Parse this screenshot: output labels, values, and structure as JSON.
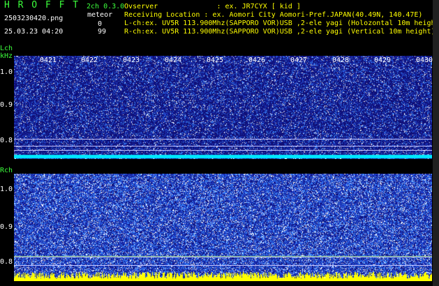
{
  "header": {
    "app_title": "H R O F F T",
    "channels": "2ch 0.3.0",
    "filename": "2503230420.png",
    "datetime": "25.03.23 04:20",
    "meteor_label": "meteor",
    "meteor_lch": "0",
    "meteor_rch": "99",
    "observer_line": "Ovserver              : ex. JR7CYX [ kid ]",
    "location_line": "Receiving Location : ex. Aomori City Aomori-Pref.JAPAN(40.49N, 140.47E)",
    "lch_line": "L-ch:ex. UV5R 113.900Mhz(SAPPORO VOR)USB ,2-ele yagi (Holozontal 10m height)",
    "rch_line": "R-ch:ex. UV5R 113.900Mhz(SAPPORO VOR)USB ,2-ele yagi (Vertical 10m height)"
  },
  "lch": {
    "label": "Lch",
    "unit": "kHz",
    "y_ticks": [
      "1.0",
      "0.9",
      "0.8"
    ],
    "time_ticks": [
      "0421",
      "0422",
      "0423",
      "0424",
      "0425",
      "0426",
      "0427",
      "0428",
      "0429",
      "0430"
    ]
  },
  "rch": {
    "label": "Rch",
    "y_ticks": [
      "1.0",
      "0.9",
      "0.8"
    ]
  },
  "colors": {
    "background": "#000000",
    "title_green": "#3cff3c",
    "noise_dark": "#101080",
    "noise_mid": "#3a7cff",
    "noise_bright": "#ffffff",
    "carrier_cyan": "#00ffff",
    "meteor_yellow": "#ffff00"
  }
}
